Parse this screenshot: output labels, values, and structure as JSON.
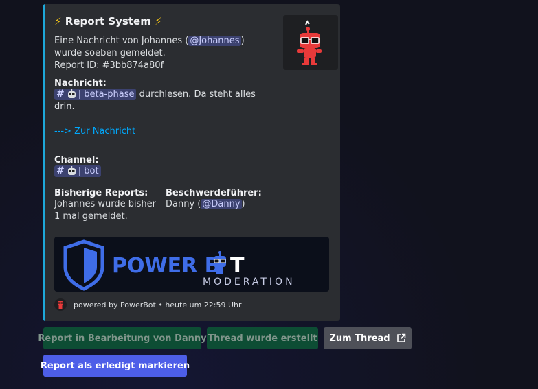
{
  "embed": {
    "title_bolt_left": "⚡",
    "title": "Report System",
    "title_bolt_right": "⚡",
    "description": {
      "prefix": "Eine Nachricht von Johannes (",
      "mention": "@Johannes",
      "suffix": ") wurde soeben gemeldet.",
      "report_id": "Report ID: #3bb874a80f"
    },
    "fields": {
      "message": {
        "name": "Nachricht:",
        "channel_mention": "| beta-phase",
        "text": " durchlesen. Da steht alles drin.",
        "link": "---> Zur Nachricht"
      },
      "channel": {
        "name": "Channel:",
        "channel_mention": "| bot"
      },
      "previous_reports": {
        "name": "Bisherige Reports:",
        "value": "Johannes wurde bisher 1 mal gemeldet."
      },
      "complainant": {
        "name": "Beschwerdeführer:",
        "prefix": "Danny (",
        "mention": "@Danny",
        "suffix": ")"
      }
    },
    "banner": {
      "word_left": "POWER B",
      "word_right": "T",
      "sub": "MODERATION"
    },
    "footer": {
      "text": "powered by PowerBot • heute um 22:59 Uhr"
    },
    "hash_symbol": "#"
  },
  "buttons": {
    "in_progress": "Report in Bearbeitung von Danny",
    "thread_created": "Thread wurde erstellt",
    "to_thread": "Zum Thread",
    "mark_done": "Report als erledigt markieren"
  },
  "colors": {
    "embed_border": "#1ea8d9",
    "primary_button": "#4d5ee8",
    "success_button": "#0d4d34",
    "link": "#00a8fc",
    "mascot_red": "#e83a3a"
  },
  "icons": {
    "title": "lightning-icon",
    "thumbnail": "robot-mascot",
    "channel": "hashtag-icon",
    "external_link": "external-link-icon",
    "banner_logo": "shield-icon"
  }
}
